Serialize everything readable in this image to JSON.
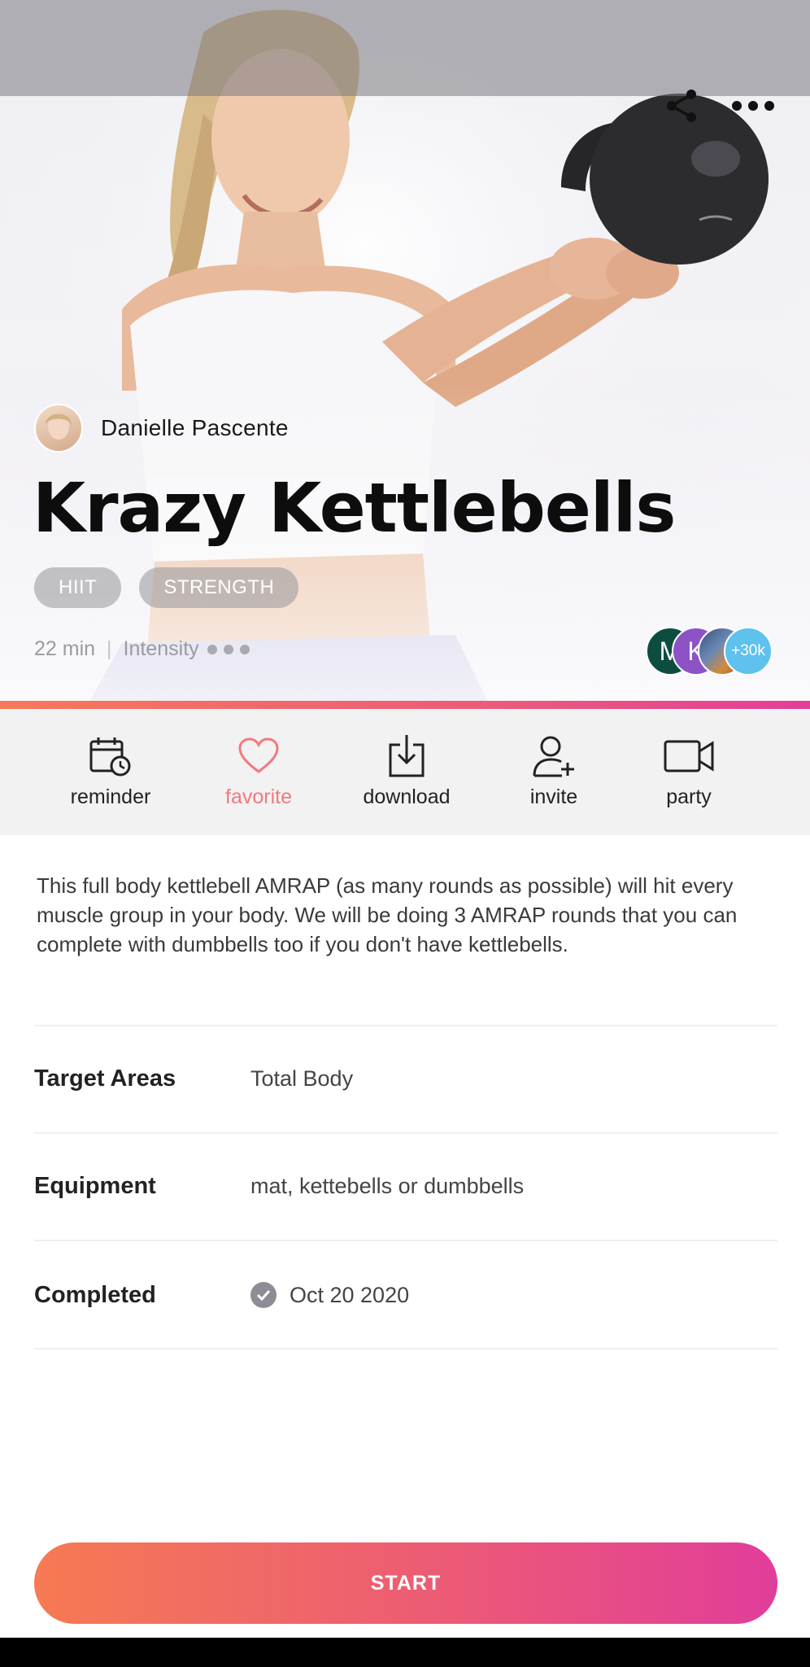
{
  "header": {
    "share_icon": "share-icon",
    "more_icon": "more-horizontal-icon"
  },
  "trainer": {
    "name": "Danielle Pascente"
  },
  "workout": {
    "title": "Krazy Kettlebells",
    "tags": [
      "HIIT",
      "STRENGTH"
    ],
    "duration": "22 min",
    "separator": "|",
    "intensity_label": "Intensity",
    "intensity_level": 3
  },
  "participants": {
    "initials": [
      "M",
      "K"
    ],
    "more_count": "+30k"
  },
  "actions": [
    {
      "label": "reminder",
      "icon": "calendar-clock-icon"
    },
    {
      "label": "favorite",
      "icon": "heart-icon",
      "color": "#f2797d"
    },
    {
      "label": "download",
      "icon": "download-icon"
    },
    {
      "label": "invite",
      "icon": "add-user-icon"
    },
    {
      "label": "party",
      "icon": "video-camera-icon"
    }
  ],
  "description": "This full body kettlebell AMRAP (as many rounds as possible) will hit every muscle group in your body. We will be doing 3 AMRAP rounds that you can complete with dumbbells too if you don't have kettlebells.",
  "details": {
    "target_label": "Target Areas",
    "target_value": "Total Body",
    "equipment_label": "Equipment",
    "equipment_value": "mat, kettebells or dumbbells",
    "completed_label": "Completed",
    "completed_value": "Oct 20 2020"
  },
  "start_label": "START",
  "colors": {
    "accent_start": "#f6795a",
    "accent_end": "#e23f98",
    "favorite": "#f2797d",
    "participant_m": "#0d4d3f",
    "participant_k": "#8e52c7",
    "participant_count": "#5ec1ee"
  }
}
